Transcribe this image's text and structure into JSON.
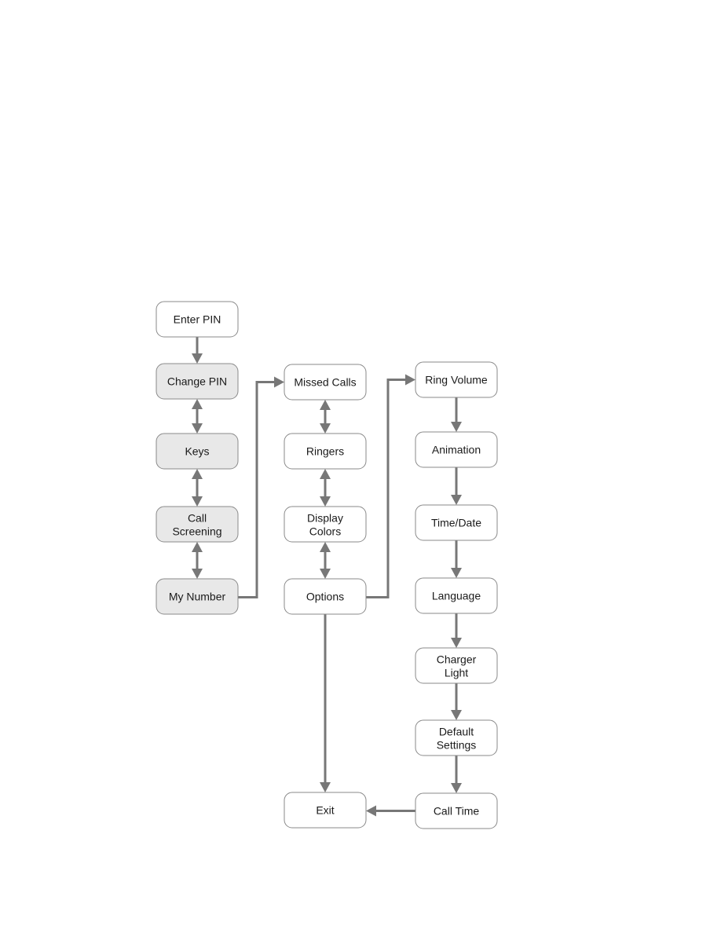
{
  "colors": {
    "highlight_fill": "#e8e8e8",
    "normal_fill": "#ffffff",
    "connector": "#777777"
  },
  "nodes": {
    "enter_pin": [
      "Enter PIN"
    ],
    "change_pin": [
      "Change PIN"
    ],
    "keys": [
      "Keys"
    ],
    "call_screening": [
      "Call",
      "Screening"
    ],
    "my_number": [
      "My Number"
    ],
    "missed_calls": [
      "Missed Calls"
    ],
    "ringers": [
      "Ringers"
    ],
    "display_colors": [
      "Display",
      "Colors"
    ],
    "options": [
      "Options"
    ],
    "exit": [
      "Exit"
    ],
    "ring_volume": [
      "Ring Volume"
    ],
    "animation": [
      "Animation"
    ],
    "time_date": [
      "Time/Date"
    ],
    "language": [
      "Language"
    ],
    "charger_light": [
      "Charger",
      "Light"
    ],
    "default_settings": [
      "Default",
      "Settings"
    ],
    "call_time": [
      "Call Time"
    ]
  },
  "highlighted": [
    "change_pin",
    "keys",
    "call_screening",
    "my_number"
  ],
  "edges": [
    {
      "from": "enter_pin",
      "to": "change_pin",
      "type": "one-way"
    },
    {
      "from": "change_pin",
      "to": "keys",
      "type": "two-way"
    },
    {
      "from": "keys",
      "to": "call_screening",
      "type": "two-way"
    },
    {
      "from": "call_screening",
      "to": "my_number",
      "type": "two-way"
    },
    {
      "from": "my_number",
      "to": "missed_calls",
      "type": "one-way"
    },
    {
      "from": "missed_calls",
      "to": "ringers",
      "type": "two-way"
    },
    {
      "from": "ringers",
      "to": "display_colors",
      "type": "two-way"
    },
    {
      "from": "display_colors",
      "to": "options",
      "type": "two-way"
    },
    {
      "from": "options",
      "to": "ring_volume",
      "type": "one-way"
    },
    {
      "from": "options",
      "to": "exit",
      "type": "one-way"
    },
    {
      "from": "ring_volume",
      "to": "animation",
      "type": "one-way"
    },
    {
      "from": "animation",
      "to": "time_date",
      "type": "one-way"
    },
    {
      "from": "time_date",
      "to": "language",
      "type": "one-way"
    },
    {
      "from": "language",
      "to": "charger_light",
      "type": "one-way"
    },
    {
      "from": "charger_light",
      "to": "default_settings",
      "type": "one-way"
    },
    {
      "from": "default_settings",
      "to": "call_time",
      "type": "one-way"
    },
    {
      "from": "call_time",
      "to": "exit",
      "type": "one-way"
    }
  ]
}
